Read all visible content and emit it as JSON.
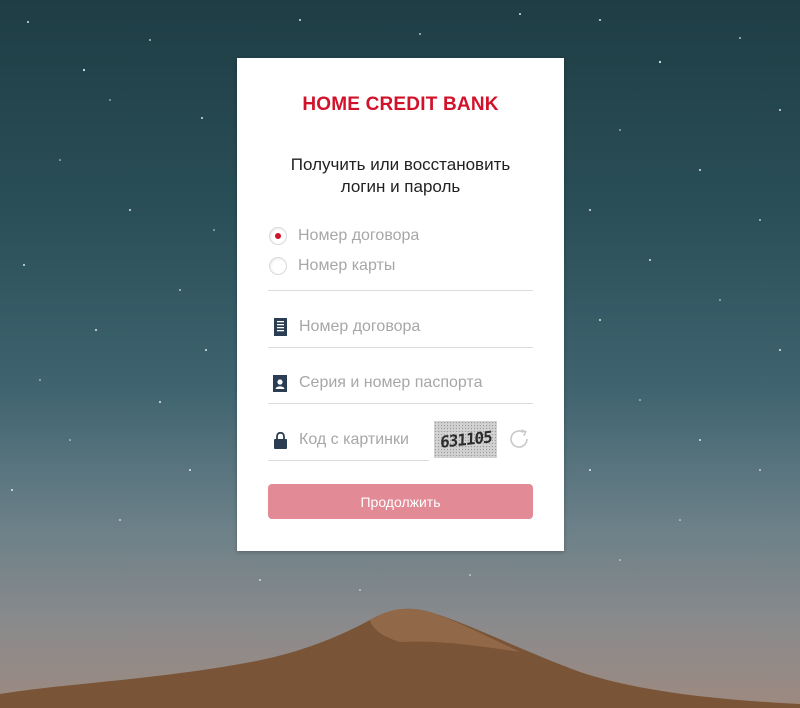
{
  "brand": {
    "logo_text": "HOME CREDIT BANK",
    "accent_color": "#d1122a"
  },
  "form": {
    "title_line1": "Получить или восстановить",
    "title_line2": "логин и пароль",
    "radio_options": [
      {
        "label": "Номер договора",
        "checked": true
      },
      {
        "label": "Номер карты",
        "checked": false
      }
    ],
    "contract_field": {
      "placeholder": "Номер договора",
      "value": "",
      "icon": "document-icon"
    },
    "passport_field": {
      "placeholder": "Серия и номер паспорта",
      "value": "",
      "icon": "id-card-icon"
    },
    "captcha_field": {
      "placeholder": "Код с картинки",
      "value": "",
      "icon": "lock-icon"
    },
    "captcha_image_text": "631105",
    "refresh_icon": "refresh-icon",
    "submit_label": "Продолжить",
    "submit_color": "#e28a95"
  },
  "background": {
    "description_colors": {
      "sky_top": "#1f3d45",
      "sky_bottom": "#8a8a8c",
      "mountain": "#7a5436"
    }
  }
}
